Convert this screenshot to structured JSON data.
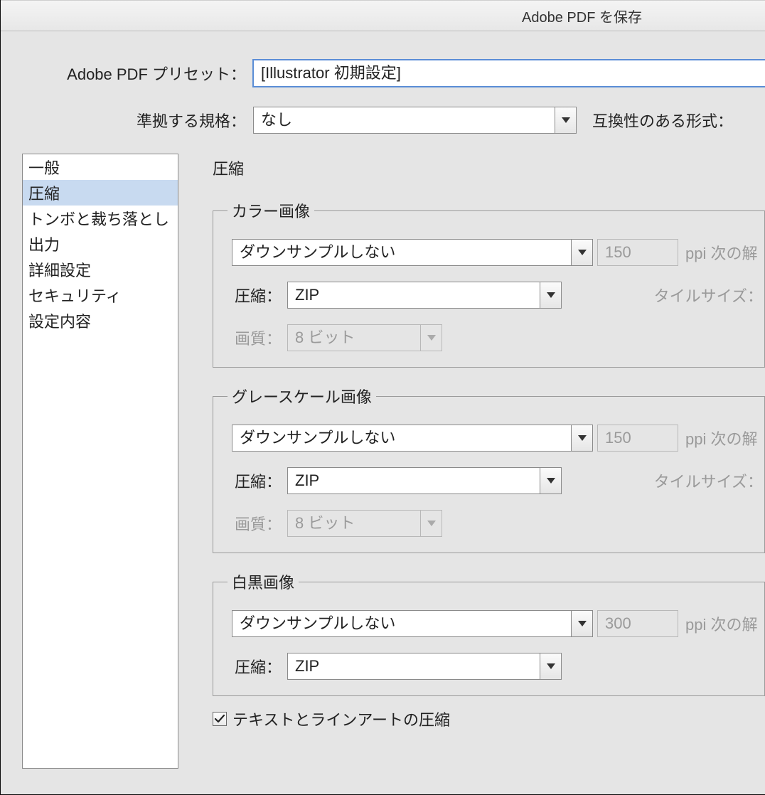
{
  "window": {
    "title": "Adobe PDF を保存"
  },
  "labels": {
    "preset": "Adobe PDF プリセット：",
    "standard": "準拠する規格：",
    "compatibility": "互換性のある形式：",
    "compression_label": "圧縮：",
    "quality_label": "画質：",
    "ppi_above": "ppi 次の解",
    "tile_size": "タイルサイズ："
  },
  "preset": {
    "value": "[Illustrator 初期設定]"
  },
  "standard": {
    "value": "なし"
  },
  "sidebar": {
    "items": [
      {
        "label": "一般"
      },
      {
        "label": "圧縮"
      },
      {
        "label": "トンボと裁ち落とし"
      },
      {
        "label": "出力"
      },
      {
        "label": "詳細設定"
      },
      {
        "label": "セキュリティ"
      },
      {
        "label": "設定内容"
      }
    ],
    "selected_index": 1
  },
  "panel": {
    "heading": "圧縮",
    "groups": {
      "color": {
        "legend": "カラー画像",
        "downsample": "ダウンサンプルしない",
        "ppi": "150",
        "compression": "ZIP",
        "quality": "8 ビット"
      },
      "gray": {
        "legend": "グレースケール画像",
        "downsample": "ダウンサンプルしない",
        "ppi": "150",
        "compression": "ZIP",
        "quality": "8 ビット"
      },
      "mono": {
        "legend": "白黒画像",
        "downsample": "ダウンサンプルしない",
        "ppi": "300",
        "compression": "ZIP"
      }
    },
    "compress_text_lineart": {
      "label": "テキストとラインアートの圧縮",
      "checked": true
    }
  }
}
